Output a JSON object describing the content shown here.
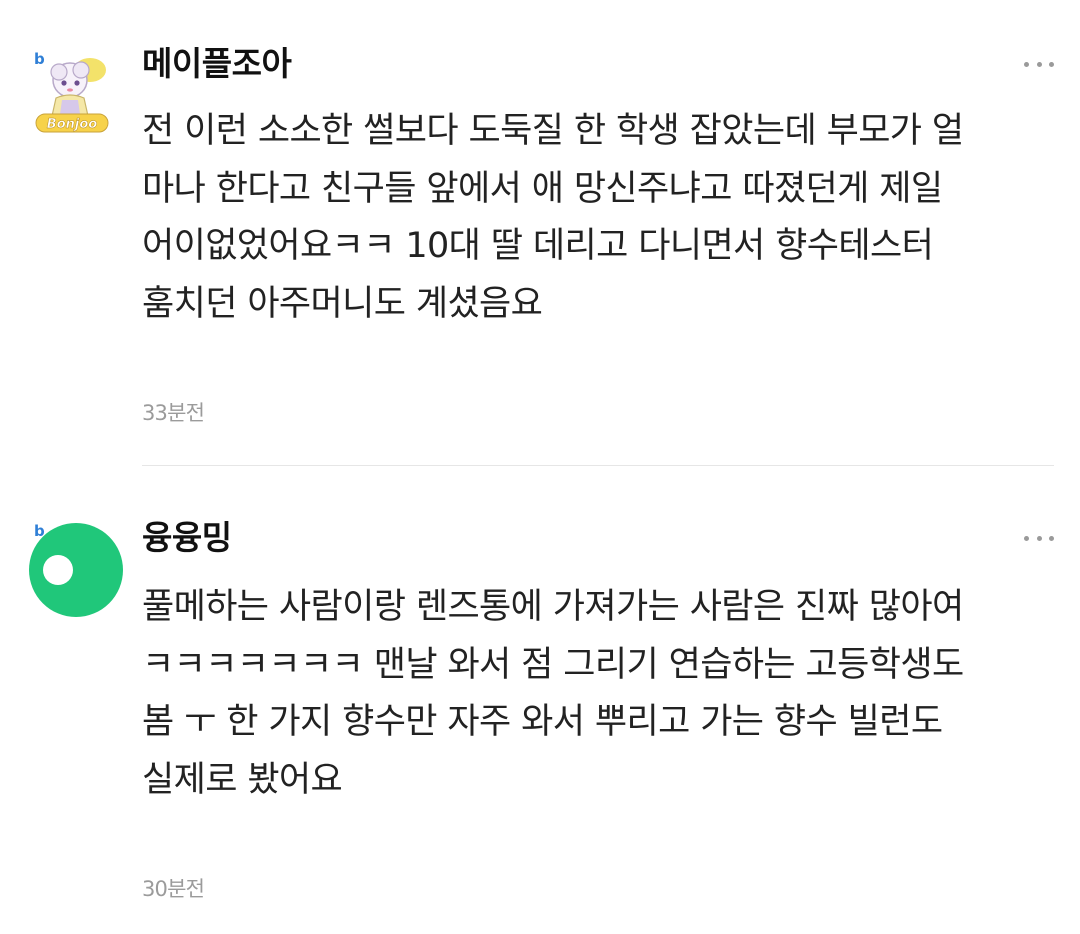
{
  "comments": [
    {
      "level_badge": "b",
      "nickname": "메이플조아",
      "body": "전 이런 소소한 썰보다 도둑질 한 학생 잡았는데 부모가 얼\n마나 한다고 친구들 앞에서 애 망신주냐고 따졌던게 제일\n어이없었어요ㅋㅋ 10대 딸 데리고 다니면서 향수테스터\n훔치던 아주머니도 계셨음요",
      "time": "33분전",
      "avatar": "cartoon-character-avatar",
      "avatar_logo_text": "Bonjoo"
    },
    {
      "level_badge": "b",
      "nickname": "융융밍",
      "body": "풀메하는 사람이랑 렌즈통에 가져가는 사람은 진짜 많아여\nㅋㅋㅋㅋㅋㅋㅋ 맨날 와서 점 그리기 연습하는 고등학생도\n봄 ㅜ 한 가지 향수만 자주 와서 뿌리고 가는 향수 빌런도\n실제로 봤어요",
      "time": "30분전",
      "avatar": "default-green-avatar"
    }
  ],
  "colors": {
    "default_avatar_green": "#20c77a",
    "level_badge_blue": "#2f7fd6",
    "timestamp_gray": "#9b9b9b",
    "more_dots_gray": "#9a9a9a"
  },
  "icons": {
    "more": "more-options-icon"
  }
}
